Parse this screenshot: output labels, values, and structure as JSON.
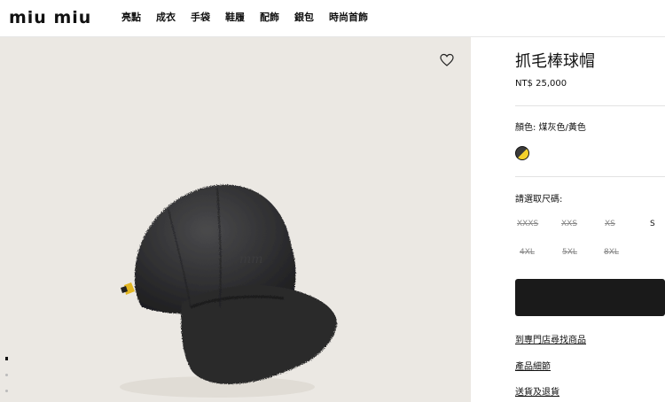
{
  "header": {
    "logo": "miu miu",
    "nav": [
      "亮點",
      "成衣",
      "手袋",
      "鞋履",
      "配飾",
      "銀包",
      "時尚首飾"
    ]
  },
  "gallery": {
    "wishlist_icon": "heart-icon",
    "dot_count": 3,
    "active_dot": 1,
    "background_color": "#ebe8e3"
  },
  "product": {
    "title": "抓毛棒球帽",
    "price": "NT$ 25,000",
    "color_label": "顏色:  煤灰色/黃色",
    "swatch_colors": [
      "#3a3a3a",
      "#f4d12c"
    ],
    "size_label": "請選取尺碼:",
    "sizes": [
      {
        "label": "XXXS",
        "available": false
      },
      {
        "label": "XXS",
        "available": false
      },
      {
        "label": "XS",
        "available": false
      },
      {
        "label": "S",
        "available": true
      },
      {
        "label": "4XL",
        "available": false
      },
      {
        "label": "5XL",
        "available": false
      },
      {
        "label": "8XL",
        "available": false
      }
    ],
    "links": [
      "到專門店尋找商品",
      "產品細節",
      "送貨及退貨"
    ]
  }
}
